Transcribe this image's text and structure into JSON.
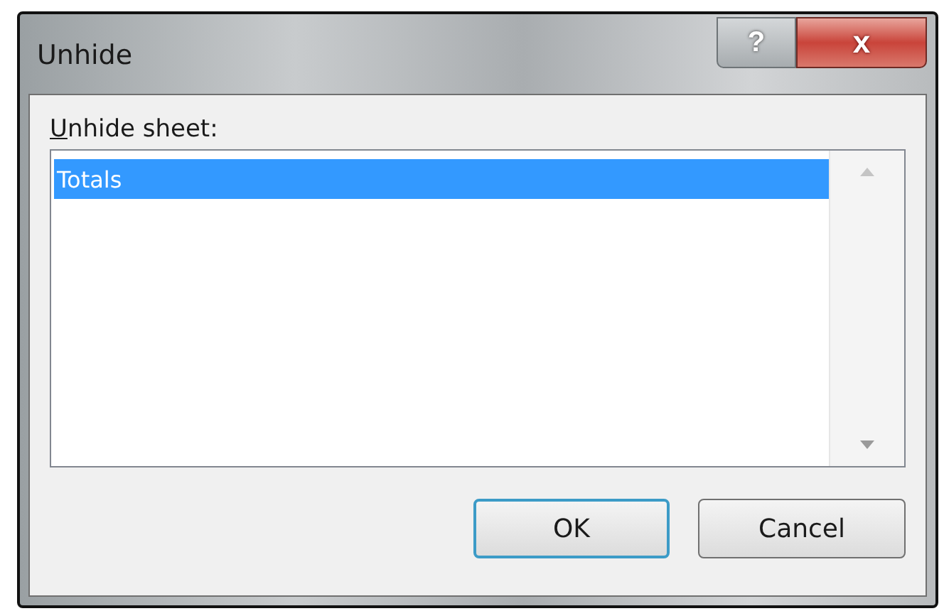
{
  "window": {
    "title": "Unhide",
    "help_button": "?",
    "close_button": "x"
  },
  "label": "Unhide sheet:",
  "sheets": [
    {
      "name": "Totals",
      "selected": true
    }
  ],
  "buttons": [
    {
      "label": "OK",
      "default": true
    },
    {
      "label": "Cancel",
      "default": false
    }
  ]
}
